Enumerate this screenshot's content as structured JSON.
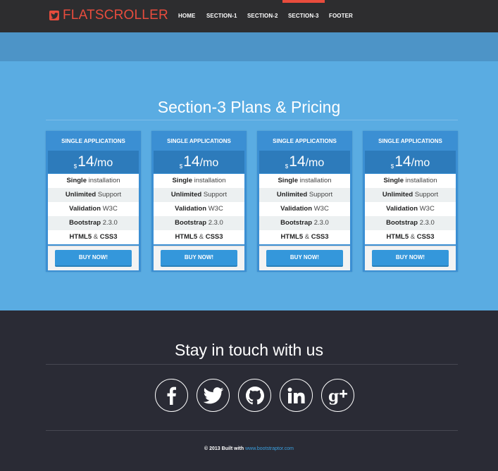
{
  "brand": {
    "name": "FLATSCROLLER",
    "icon": "twitter-icon",
    "color": "#e84c3d"
  },
  "nav": {
    "items": [
      {
        "label": "HOME"
      },
      {
        "label": "SECTION-1"
      },
      {
        "label": "SECTION-2"
      },
      {
        "label": "SECTION-3",
        "active": true
      },
      {
        "label": "FOOTER"
      }
    ]
  },
  "pricing": {
    "title": "Section-3 Plans & Pricing",
    "plans": [
      {
        "name": "SINGLE APPLICATIONS",
        "currency": "$",
        "amount": "14",
        "period": "/mo",
        "button": "BUY NOW!"
      },
      {
        "name": "SINGLE APPLICATIONS",
        "currency": "$",
        "amount": "14",
        "period": "/mo",
        "button": "BUY NOW!"
      },
      {
        "name": "SINGLE APPLICATIONS",
        "currency": "$",
        "amount": "14",
        "period": "/mo",
        "button": "BUY NOW!"
      },
      {
        "name": "SINGLE APPLICATIONS",
        "currency": "$",
        "amount": "14",
        "period": "/mo",
        "button": "BUY NOW!"
      }
    ],
    "features": [
      {
        "bold": "Single",
        "rest": "installation"
      },
      {
        "bold": "Unlimited",
        "rest": "Support"
      },
      {
        "bold": "Validation",
        "rest": "W3C"
      },
      {
        "bold": "Bootstrap",
        "rest": "2.3.0"
      },
      {
        "bold": "HTML5",
        "rest": "&",
        "bold2": "CSS3"
      }
    ]
  },
  "footer": {
    "title": "Stay in touch with us",
    "social": [
      "facebook-icon",
      "twitter-icon",
      "github-icon",
      "linkedin-icon",
      "google-plus-icon"
    ],
    "copyright_prefix": "© 2013 Built with",
    "copyright_link": "www.bootstraptor.com"
  },
  "colors": {
    "navbar": "#2d2d2f",
    "subbar": "#4d94c7",
    "pricing_bg": "#5aace2",
    "plan_header": "#3b8fd3",
    "plan_price": "#2d7bbb",
    "button": "#3497db",
    "footer_bg": "#2a2b35",
    "link": "#3aa0e0"
  }
}
